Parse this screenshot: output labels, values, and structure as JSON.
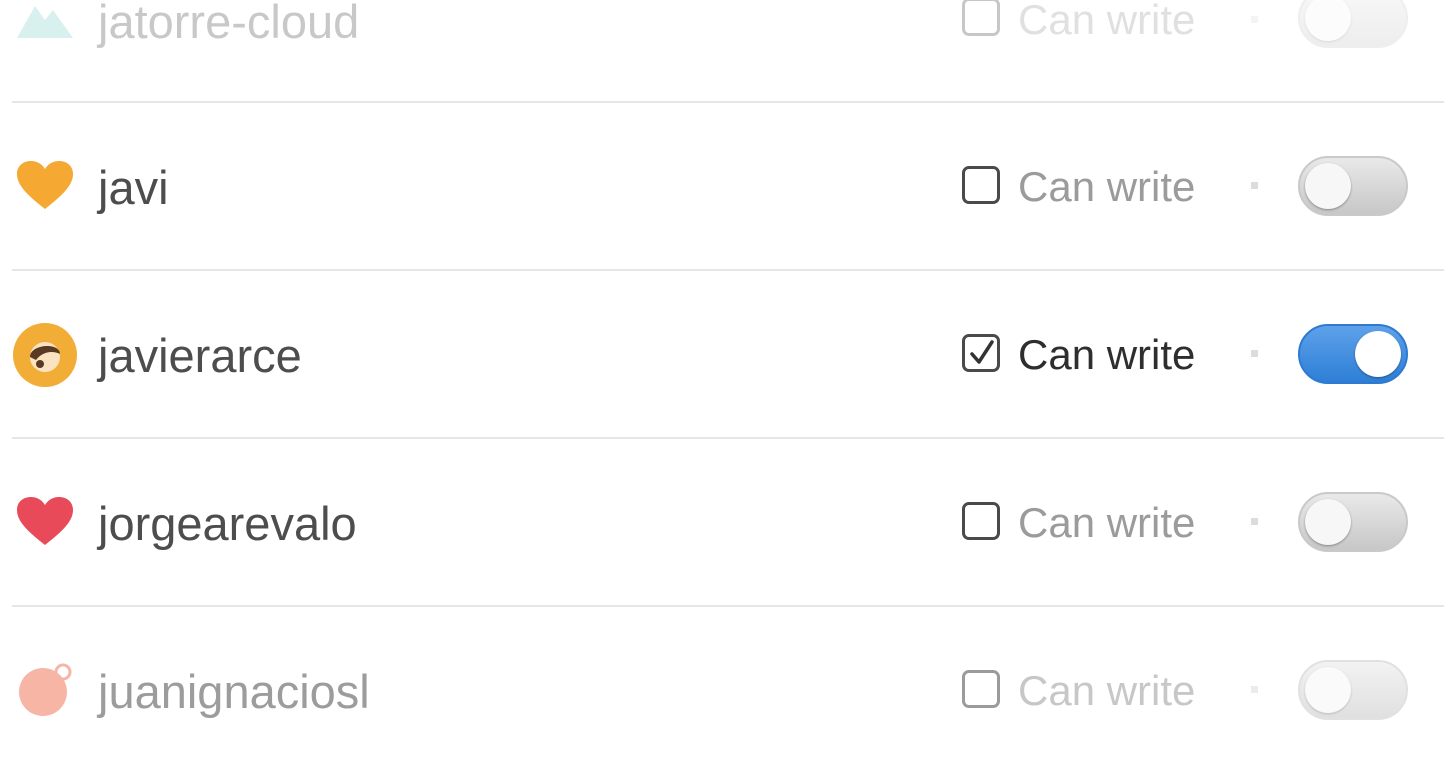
{
  "members": [
    {
      "username": "jatorre-cloud",
      "avatar_icon": "mountain-icon",
      "avatar_color": "#7fd0c8",
      "permission_label": "Can write",
      "can_write": false,
      "enabled": false
    },
    {
      "username": "javi",
      "avatar_icon": "heart-icon",
      "avatar_color": "#f5a832",
      "permission_label": "Can write",
      "can_write": false,
      "enabled": false
    },
    {
      "username": "javierarce",
      "avatar_icon": "avatar-face-icon",
      "avatar_color": "#f2ad37",
      "permission_label": "Can write",
      "can_write": true,
      "enabled": true
    },
    {
      "username": "jorgearevalo",
      "avatar_icon": "heart-icon",
      "avatar_color": "#e84a5a",
      "permission_label": "Can write",
      "can_write": false,
      "enabled": false
    },
    {
      "username": "juanignaciosl",
      "avatar_icon": "avatar-blob-icon",
      "avatar_color": "#f07a5c",
      "permission_label": "Can write",
      "can_write": false,
      "enabled": false
    }
  ],
  "colors": {
    "toggle_on": "#3a8be0",
    "separator": "#e6e6e6",
    "label_off": "#9b9b9b",
    "label_on": "#2e2e2e"
  }
}
